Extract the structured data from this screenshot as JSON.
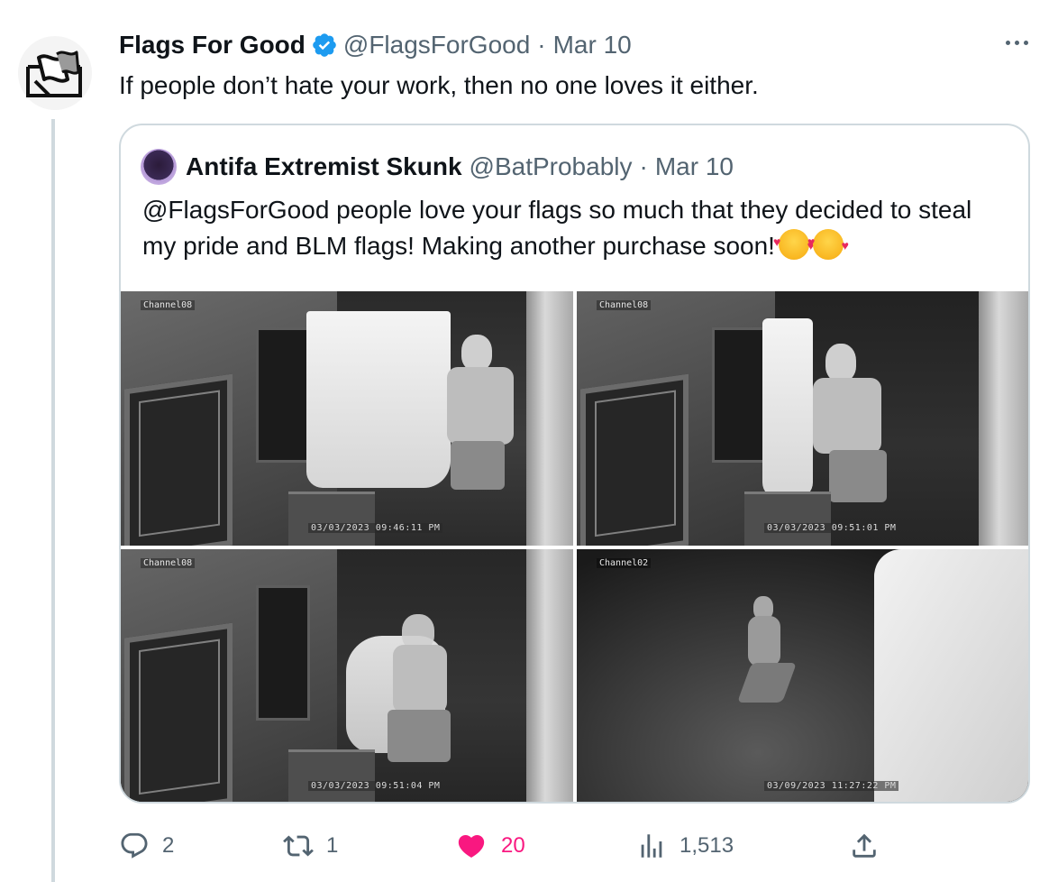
{
  "tweet": {
    "author_name": "Flags For Good",
    "handle": "@FlagsForGood",
    "separator": "·",
    "date": "Mar 10",
    "text": "If people don’t hate your work, then no one loves it either."
  },
  "quoted_tweet": {
    "author_name": "Antifa Extremist Skunk",
    "handle": "@BatProbably",
    "separator": "·",
    "date": "Mar 10",
    "text": "@FlagsForGood people love your flags so much that they decided to steal my pride and BLM flags! Making another purchase soon!",
    "emojis": [
      "smiling-face-with-hearts",
      "smiling-face-with-hearts"
    ],
    "media": [
      {
        "channel": "Channel08",
        "timestamp": "03/03/2023 09:46:11 PM"
      },
      {
        "channel": "Channel08",
        "timestamp": "03/03/2023 09:51:01 PM"
      },
      {
        "channel": "Channel08",
        "timestamp": "03/03/2023 09:51:04 PM"
      },
      {
        "channel": "Channel02",
        "timestamp": "03/09/2023 11:27:22 PM"
      }
    ]
  },
  "actions": {
    "replies": "2",
    "retweets": "1",
    "likes": "20",
    "views": "1,513"
  },
  "colors": {
    "text_primary": "#0f1419",
    "text_secondary": "#536471",
    "verified_blue": "#1d9bf0",
    "like_pink": "#f91880",
    "border": "#cfd9de"
  },
  "icons": {
    "verified": "verified-badge-icon",
    "more": "more-icon",
    "reply": "reply-icon",
    "retweet": "retweet-icon",
    "like": "heart-icon",
    "views": "views-icon",
    "share": "share-icon"
  }
}
